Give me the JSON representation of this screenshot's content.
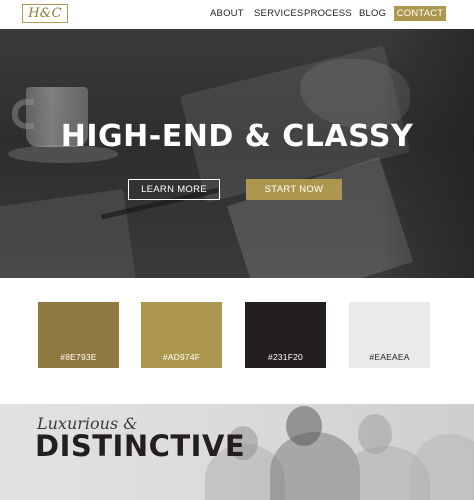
{
  "header": {
    "logo_text": "H&C",
    "nav": [
      "ABOUT",
      "SERVICES",
      "PROCESS",
      "BLOG"
    ],
    "contact_label": "CONTACT"
  },
  "hero": {
    "title": "HIGH-END & CLASSY",
    "learn_more_label": "LEARN MORE",
    "start_now_label": "START NOW"
  },
  "swatches": [
    {
      "label": "#8E793E",
      "color": "#8E793E"
    },
    {
      "label": "#AD974F",
      "color": "#AD974F"
    },
    {
      "label": "#231F20",
      "color": "#231F20"
    },
    {
      "label": "#EAEAEA",
      "color": "#EAEAEA"
    }
  ],
  "banner": {
    "script_text": "Luxurious &",
    "title": "DISTINCTIVE"
  },
  "colors": {
    "accent": "#AD974F",
    "accent_dark": "#8E793E",
    "dark": "#231F20",
    "light": "#EAEAEA"
  }
}
